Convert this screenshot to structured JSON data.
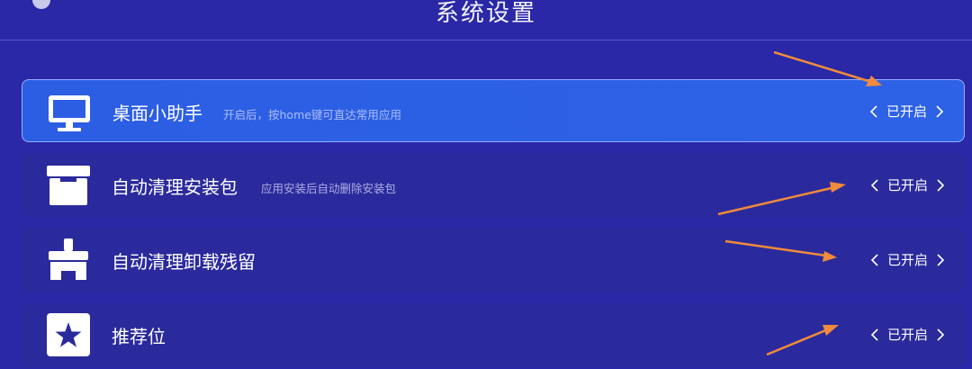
{
  "header": {
    "title": "系统设置"
  },
  "settings": [
    {
      "label": "桌面小助手",
      "description": "开启后，按home键可直达常用应用",
      "value": "已开启",
      "icon": "monitor-icon"
    },
    {
      "label": "自动清理安装包",
      "description": "应用安装后自动删除安装包",
      "value": "已开启",
      "icon": "package-box-icon"
    },
    {
      "label": "自动清理卸载残留",
      "description": "",
      "value": "已开启",
      "icon": "broom-icon"
    },
    {
      "label": "推荐位",
      "description": "",
      "value": "已开启",
      "icon": "star-icon"
    }
  ],
  "colors": {
    "background": "#2a28a6",
    "focused_row": "#2d62e6",
    "annotation_arrow": "#f08a3c"
  }
}
